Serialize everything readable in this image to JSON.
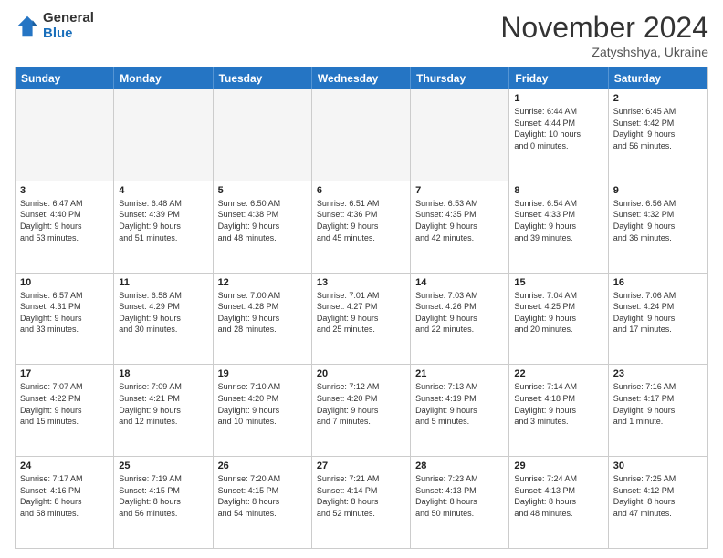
{
  "logo": {
    "general": "General",
    "blue": "Blue"
  },
  "header": {
    "month": "November 2024",
    "location": "Zatyshshya, Ukraine"
  },
  "weekdays": [
    "Sunday",
    "Monday",
    "Tuesday",
    "Wednesday",
    "Thursday",
    "Friday",
    "Saturday"
  ],
  "rows": [
    [
      {
        "day": "",
        "info": "",
        "empty": true
      },
      {
        "day": "",
        "info": "",
        "empty": true
      },
      {
        "day": "",
        "info": "",
        "empty": true
      },
      {
        "day": "",
        "info": "",
        "empty": true
      },
      {
        "day": "",
        "info": "",
        "empty": true
      },
      {
        "day": "1",
        "info": "Sunrise: 6:44 AM\nSunset: 4:44 PM\nDaylight: 10 hours\nand 0 minutes."
      },
      {
        "day": "2",
        "info": "Sunrise: 6:45 AM\nSunset: 4:42 PM\nDaylight: 9 hours\nand 56 minutes."
      }
    ],
    [
      {
        "day": "3",
        "info": "Sunrise: 6:47 AM\nSunset: 4:40 PM\nDaylight: 9 hours\nand 53 minutes."
      },
      {
        "day": "4",
        "info": "Sunrise: 6:48 AM\nSunset: 4:39 PM\nDaylight: 9 hours\nand 51 minutes."
      },
      {
        "day": "5",
        "info": "Sunrise: 6:50 AM\nSunset: 4:38 PM\nDaylight: 9 hours\nand 48 minutes."
      },
      {
        "day": "6",
        "info": "Sunrise: 6:51 AM\nSunset: 4:36 PM\nDaylight: 9 hours\nand 45 minutes."
      },
      {
        "day": "7",
        "info": "Sunrise: 6:53 AM\nSunset: 4:35 PM\nDaylight: 9 hours\nand 42 minutes."
      },
      {
        "day": "8",
        "info": "Sunrise: 6:54 AM\nSunset: 4:33 PM\nDaylight: 9 hours\nand 39 minutes."
      },
      {
        "day": "9",
        "info": "Sunrise: 6:56 AM\nSunset: 4:32 PM\nDaylight: 9 hours\nand 36 minutes."
      }
    ],
    [
      {
        "day": "10",
        "info": "Sunrise: 6:57 AM\nSunset: 4:31 PM\nDaylight: 9 hours\nand 33 minutes."
      },
      {
        "day": "11",
        "info": "Sunrise: 6:58 AM\nSunset: 4:29 PM\nDaylight: 9 hours\nand 30 minutes."
      },
      {
        "day": "12",
        "info": "Sunrise: 7:00 AM\nSunset: 4:28 PM\nDaylight: 9 hours\nand 28 minutes."
      },
      {
        "day": "13",
        "info": "Sunrise: 7:01 AM\nSunset: 4:27 PM\nDaylight: 9 hours\nand 25 minutes."
      },
      {
        "day": "14",
        "info": "Sunrise: 7:03 AM\nSunset: 4:26 PM\nDaylight: 9 hours\nand 22 minutes."
      },
      {
        "day": "15",
        "info": "Sunrise: 7:04 AM\nSunset: 4:25 PM\nDaylight: 9 hours\nand 20 minutes."
      },
      {
        "day": "16",
        "info": "Sunrise: 7:06 AM\nSunset: 4:24 PM\nDaylight: 9 hours\nand 17 minutes."
      }
    ],
    [
      {
        "day": "17",
        "info": "Sunrise: 7:07 AM\nSunset: 4:22 PM\nDaylight: 9 hours\nand 15 minutes."
      },
      {
        "day": "18",
        "info": "Sunrise: 7:09 AM\nSunset: 4:21 PM\nDaylight: 9 hours\nand 12 minutes."
      },
      {
        "day": "19",
        "info": "Sunrise: 7:10 AM\nSunset: 4:20 PM\nDaylight: 9 hours\nand 10 minutes."
      },
      {
        "day": "20",
        "info": "Sunrise: 7:12 AM\nSunset: 4:20 PM\nDaylight: 9 hours\nand 7 minutes."
      },
      {
        "day": "21",
        "info": "Sunrise: 7:13 AM\nSunset: 4:19 PM\nDaylight: 9 hours\nand 5 minutes."
      },
      {
        "day": "22",
        "info": "Sunrise: 7:14 AM\nSunset: 4:18 PM\nDaylight: 9 hours\nand 3 minutes."
      },
      {
        "day": "23",
        "info": "Sunrise: 7:16 AM\nSunset: 4:17 PM\nDaylight: 9 hours\nand 1 minute."
      }
    ],
    [
      {
        "day": "24",
        "info": "Sunrise: 7:17 AM\nSunset: 4:16 PM\nDaylight: 8 hours\nand 58 minutes."
      },
      {
        "day": "25",
        "info": "Sunrise: 7:19 AM\nSunset: 4:15 PM\nDaylight: 8 hours\nand 56 minutes."
      },
      {
        "day": "26",
        "info": "Sunrise: 7:20 AM\nSunset: 4:15 PM\nDaylight: 8 hours\nand 54 minutes."
      },
      {
        "day": "27",
        "info": "Sunrise: 7:21 AM\nSunset: 4:14 PM\nDaylight: 8 hours\nand 52 minutes."
      },
      {
        "day": "28",
        "info": "Sunrise: 7:23 AM\nSunset: 4:13 PM\nDaylight: 8 hours\nand 50 minutes."
      },
      {
        "day": "29",
        "info": "Sunrise: 7:24 AM\nSunset: 4:13 PM\nDaylight: 8 hours\nand 48 minutes."
      },
      {
        "day": "30",
        "info": "Sunrise: 7:25 AM\nSunset: 4:12 PM\nDaylight: 8 hours\nand 47 minutes."
      }
    ]
  ]
}
